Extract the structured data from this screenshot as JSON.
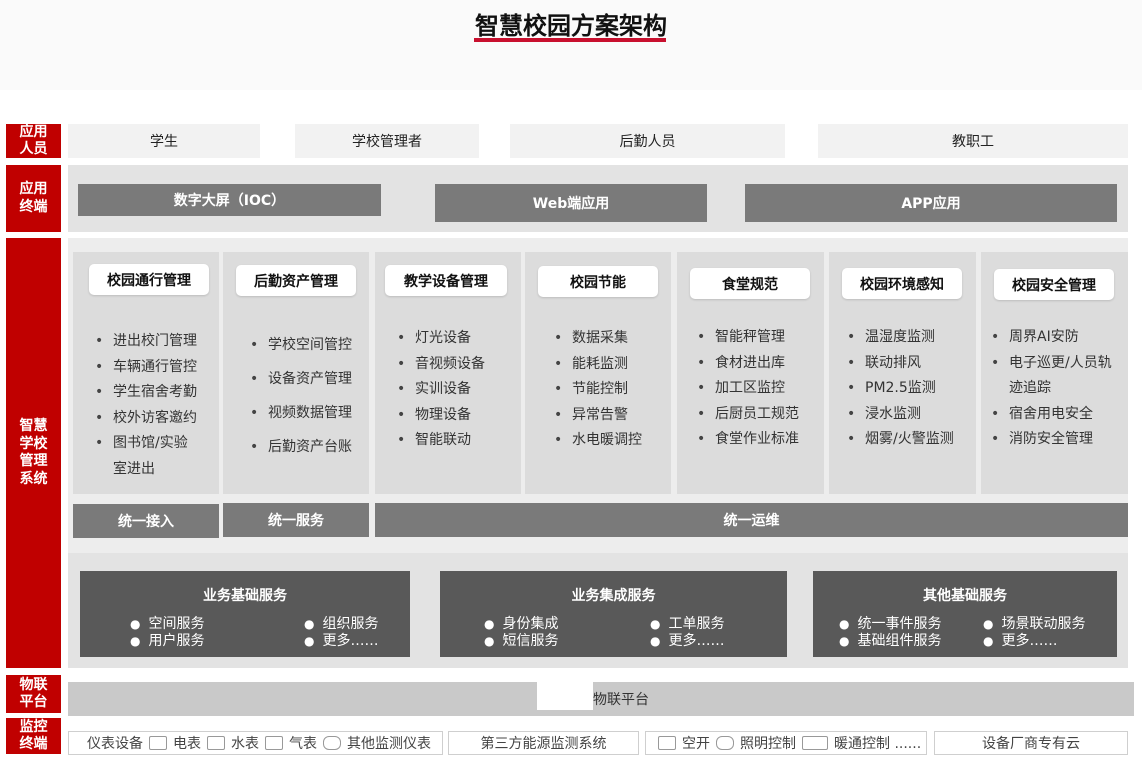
{
  "title": "智慧校园方案架构",
  "layers": {
    "users": {
      "label": "应用\n人员",
      "items": [
        "学生",
        "学校管理者",
        "后勤人员",
        "教职工"
      ]
    },
    "terminals": {
      "label": "应用\n终端",
      "items": [
        "数字大屏（IOC）",
        "Web端应用",
        "APP应用"
      ]
    },
    "system": {
      "label": "智慧\n学校\n管理\n系统"
    },
    "iot": {
      "label": "物联\n平台",
      "bar": "物联平台"
    },
    "monitor": {
      "label": "监控\n终端"
    }
  },
  "modules": [
    {
      "title": "校园通行管理",
      "items": [
        "进出校门管理",
        "车辆通行管控",
        "学生宿舍考勤",
        "校外访客邀约",
        "图书馆/实验\n室进出"
      ]
    },
    {
      "title": "后勤资产管理",
      "items": [
        "学校空间管控",
        "设备资产管理",
        "视频数据管理",
        "后勤资产台账"
      ]
    },
    {
      "title": "教学设备管理",
      "items": [
        "灯光设备",
        "音视频设备",
        "实训设备",
        "物理设备",
        "智能联动"
      ]
    },
    {
      "title": "校园节能",
      "items": [
        "数据采集",
        "能耗监测",
        "节能控制",
        "异常告警",
        "水电暖调控"
      ]
    },
    {
      "title": "食堂规范",
      "items": [
        "智能秤管理",
        "食材进出库",
        "加工区监控",
        "后厨员工规范",
        "食堂作业标准"
      ]
    },
    {
      "title": "校园环境感知",
      "items": [
        "温湿度监测",
        "联动排风",
        "PM2.5监测",
        "浸水监测",
        "烟雾/火警监测"
      ]
    },
    {
      "title": "校园安全管理",
      "items": [
        "周界AI安防",
        "电子巡更/人员轨\n迹追踪",
        "宿舍用电安全",
        "消防安全管理"
      ]
    }
  ],
  "unified": [
    "统一接入",
    "统一服务",
    "统一运维"
  ],
  "services": [
    {
      "title": "业务基础服务",
      "items": [
        "空间服务",
        "组织服务",
        "用户服务",
        "更多……"
      ]
    },
    {
      "title": "业务集成服务",
      "items": [
        "身份集成",
        "工单服务",
        "短信服务",
        "更多……"
      ]
    },
    {
      "title": "其他基础服务",
      "items": [
        "统一事件服务",
        "场景联动服务",
        "基础组件服务",
        "更多……"
      ]
    }
  ],
  "monitor_terminals": {
    "meters": [
      "仪表设备",
      "电表",
      "水表",
      "气表",
      "其他监测仪表"
    ],
    "third_party": "第三方能源监测系统",
    "controls": [
      "空开",
      "照明控制",
      "暖通控制 ......"
    ],
    "vendor_cloud": "设备厂商专有云"
  },
  "colors": {
    "accent_red": "#c00000",
    "dark_gray": "#595959",
    "mid_gray": "#7a7a7a"
  }
}
